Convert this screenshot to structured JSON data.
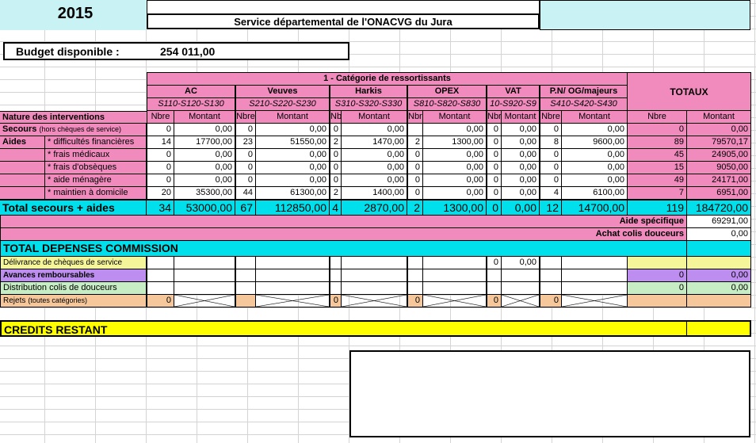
{
  "header": {
    "year": "2015",
    "service_title": "Service départemental de l'ONACVG du Jura"
  },
  "budget": {
    "label": "Budget disponible :",
    "value": "254 011,00"
  },
  "category_title": "1 - Catégorie de ressortissants",
  "nature_label": "Nature des interventions",
  "totaux_label": "TOTAUX",
  "sub_nbre": "Nbre",
  "sub_montant": "Montant",
  "categories": [
    {
      "name": "AC",
      "codes": "S110-S120-S130"
    },
    {
      "name": "Veuves",
      "codes": "S210-S220-S230"
    },
    {
      "name": "Harkis",
      "codes": "S310-S320-S330"
    },
    {
      "name": "OPEX",
      "codes": "S810-S820-S830"
    },
    {
      "name": "VAT",
      "codes": "10-S920-S9"
    },
    {
      "name": "P.N/ OG/majeurs",
      "codes": "S410-S420-S430"
    }
  ],
  "secours": {
    "label": "Secours",
    "note": "(hors chèques de service)",
    "values": [
      [
        "0",
        "0,00"
      ],
      [
        "0",
        "0,00"
      ],
      [
        "0",
        "0,00"
      ],
      [
        "",
        "0,00"
      ],
      [
        "0",
        "0,00"
      ],
      [
        "0",
        "0,00"
      ]
    ],
    "total": [
      "0",
      "0,00"
    ]
  },
  "aides_label": "Aides",
  "aides": [
    {
      "label": "* difficultés financières",
      "values": [
        [
          "14",
          "17700,00"
        ],
        [
          "23",
          "51550,00"
        ],
        [
          "2",
          "1470,00"
        ],
        [
          "2",
          "1300,00"
        ],
        [
          "0",
          "0,00"
        ],
        [
          "8",
          "9600,00"
        ]
      ],
      "total": [
        "89",
        "79570,17"
      ]
    },
    {
      "label": "* frais médicaux",
      "values": [
        [
          "0",
          "0,00"
        ],
        [
          "0",
          "0,00"
        ],
        [
          "0",
          "0,00"
        ],
        [
          "0",
          "0,00"
        ],
        [
          "0",
          "0,00"
        ],
        [
          "0",
          "0,00"
        ]
      ],
      "total": [
        "45",
        "24905,00"
      ]
    },
    {
      "label": "* frais d'obsèques",
      "values": [
        [
          "0",
          "0,00"
        ],
        [
          "0",
          "0,00"
        ],
        [
          "0",
          "0,00"
        ],
        [
          "0",
          "0,00"
        ],
        [
          "0",
          "0,00"
        ],
        [
          "0",
          "0,00"
        ]
      ],
      "total": [
        "15",
        "9050,00"
      ]
    },
    {
      "label": "* aide ménagère",
      "values": [
        [
          "0",
          "0,00"
        ],
        [
          "0",
          "0,00"
        ],
        [
          "0",
          "0,00"
        ],
        [
          "0",
          "0,00"
        ],
        [
          "0",
          "0,00"
        ],
        [
          "0",
          "0,00"
        ]
      ],
      "total": [
        "49",
        "24171,00"
      ]
    },
    {
      "label": "* maintien à domicile",
      "values": [
        [
          "20",
          "35300,00"
        ],
        [
          "44",
          "61300,00"
        ],
        [
          "2",
          "1400,00"
        ],
        [
          "0",
          "0,00"
        ],
        [
          "0",
          "0,00"
        ],
        [
          "4",
          "6100,00"
        ]
      ],
      "total": [
        "7",
        "6951,00"
      ]
    }
  ],
  "total_row": {
    "label": "Total secours + aides",
    "values": [
      [
        "34",
        "53000,00"
      ],
      [
        "67",
        "112850,00"
      ],
      [
        "4",
        "2870,00"
      ],
      [
        "2",
        "1300,00"
      ],
      [
        "0",
        "0,00"
      ],
      [
        "12",
        "14700,00"
      ]
    ],
    "total": [
      "119",
      "184720,00"
    ]
  },
  "aide_specifique": {
    "label": "Aide spécifique",
    "value": "69291,00"
  },
  "achat_colis": {
    "label": "Achat colis douceurs",
    "value": "0,00"
  },
  "total_depenses_label": "TOTAL DEPENSES COMMISSION",
  "delivrance": {
    "label": "Délivrance de chèques de service",
    "vat_nbre": "0",
    "vat_montant": "0,00"
  },
  "avances": {
    "label": "Avances remboursables",
    "nbre": "0",
    "montant": "0,00"
  },
  "distribution": {
    "label": "Distribution  colis de douceurs",
    "nbre": "0",
    "montant": "0,00"
  },
  "rejets": {
    "label": "Rejets",
    "note": "(toutes catégories)",
    "values": [
      "0",
      "0",
      "0",
      "0",
      "0"
    ]
  },
  "credits_restant_label": "CREDITS RESTANT",
  "colors": {
    "pink": "#f18bbd",
    "cyan": "#00e0ec",
    "yellow": "#ffff00",
    "purple": "#bd8df0",
    "green": "#c7edc4",
    "peach": "#f6c79b"
  }
}
